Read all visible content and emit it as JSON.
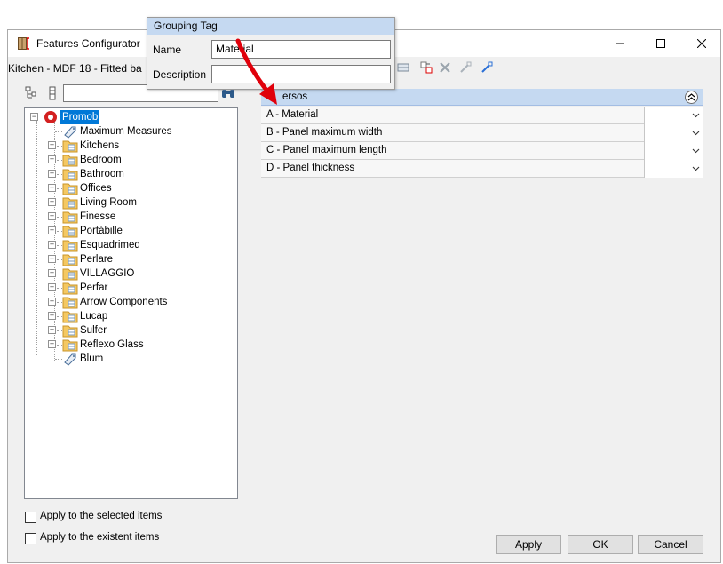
{
  "window": {
    "title": "Features Configurator",
    "subtitle": "Kitchen - MDF 18 - Fitted ba"
  },
  "popup": {
    "title": "Grouping Tag",
    "name_label": "Name",
    "name_value": "Material",
    "description_label": "Description",
    "description_value": ""
  },
  "tree": {
    "search_value": "",
    "root": "Promob",
    "items": [
      {
        "label": "Maximum Measures",
        "icon": "tag-icon",
        "expandable": false
      },
      {
        "label": "Kitchens",
        "icon": "folder-icon",
        "expandable": true
      },
      {
        "label": "Bedroom",
        "icon": "folder-icon",
        "expandable": true
      },
      {
        "label": "Bathroom",
        "icon": "folder-icon",
        "expandable": true
      },
      {
        "label": "Offices",
        "icon": "folder-icon",
        "expandable": true
      },
      {
        "label": "Living Room",
        "icon": "folder-icon",
        "expandable": true
      },
      {
        "label": "Finesse",
        "icon": "folder-icon",
        "expandable": true
      },
      {
        "label": "Portábille",
        "icon": "folder-icon",
        "expandable": true
      },
      {
        "label": "Esquadrimed",
        "icon": "folder-icon",
        "expandable": true
      },
      {
        "label": "Perlare",
        "icon": "folder-icon",
        "expandable": true
      },
      {
        "label": "VILLAGGIO",
        "icon": "folder-icon",
        "expandable": true
      },
      {
        "label": "Perfar",
        "icon": "folder-icon",
        "expandable": true
      },
      {
        "label": "Arrow Components",
        "icon": "folder-icon",
        "expandable": true
      },
      {
        "label": "Lucap",
        "icon": "folder-icon",
        "expandable": true
      },
      {
        "label": "Sulfer",
        "icon": "folder-icon",
        "expandable": true
      },
      {
        "label": "Reflexo Glass",
        "icon": "folder-icon",
        "expandable": true
      },
      {
        "label": "Blum",
        "icon": "tag-icon",
        "expandable": false
      }
    ]
  },
  "group": {
    "label": "ersos",
    "properties": [
      {
        "label": "A - Material",
        "value": ""
      },
      {
        "label": "B - Panel maximum width",
        "value": ""
      },
      {
        "label": "C - Panel maximum length",
        "value": ""
      },
      {
        "label": "D - Panel thickness",
        "value": ""
      }
    ]
  },
  "options": {
    "apply_selected": "Apply to the selected items",
    "apply_existent": "Apply to the existent items"
  },
  "buttons": {
    "apply": "Apply",
    "ok": "OK",
    "cancel": "Cancel"
  },
  "colors": {
    "header_blue": "#c5d9f1",
    "selection_blue": "#0078d7",
    "arrow_red": "#e0000b"
  }
}
